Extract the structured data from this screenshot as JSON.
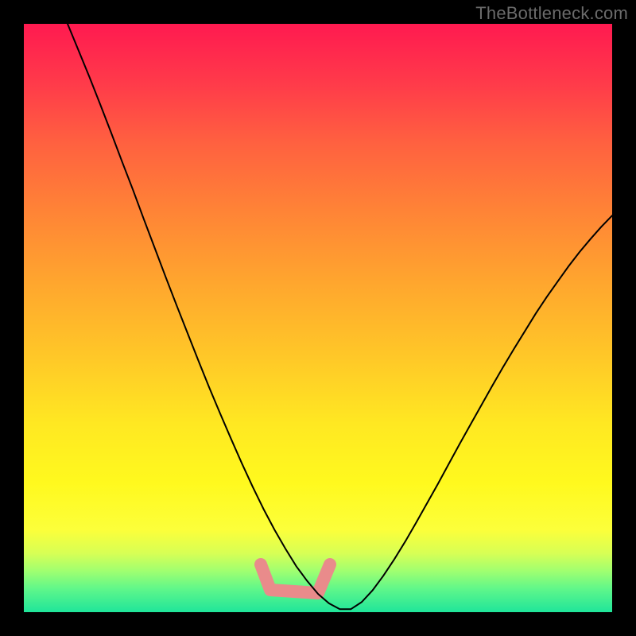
{
  "watermark": "TheBottleneck.com",
  "colors": {
    "background": "#000000",
    "curve": "#000000",
    "trough_highlight": "#e98b8b",
    "gradient_top": "#ff1a50",
    "gradient_bottom": "#1fe59a"
  },
  "chart_data": {
    "type": "line",
    "title": "",
    "xlabel": "",
    "ylabel": "",
    "xlim": [
      0,
      1
    ],
    "ylim": [
      0,
      1
    ],
    "x": [
      0.0,
      0.02,
      0.04,
      0.06,
      0.08,
      0.1,
      0.12,
      0.14,
      0.16,
      0.18,
      0.2,
      0.22,
      0.24,
      0.26,
      0.28,
      0.3,
      0.32,
      0.34,
      0.36,
      0.38,
      0.4,
      0.42,
      0.44,
      0.46,
      0.48,
      0.5,
      0.52,
      0.54,
      0.56,
      0.58,
      0.6,
      0.62,
      0.64,
      0.66,
      0.68,
      0.7,
      0.72,
      0.74,
      0.76,
      0.78,
      0.8,
      0.82,
      0.84,
      0.86,
      0.88,
      0.9,
      0.92,
      0.94,
      0.96,
      0.98,
      1.0
    ],
    "values": [
      1.0,
      0.955,
      0.91,
      0.863,
      0.815,
      0.766,
      0.718,
      0.668,
      0.619,
      0.57,
      0.522,
      0.475,
      0.428,
      0.382,
      0.338,
      0.295,
      0.253,
      0.213,
      0.175,
      0.14,
      0.108,
      0.078,
      0.053,
      0.031,
      0.015,
      0.005,
      0.005,
      0.017,
      0.037,
      0.062,
      0.09,
      0.12,
      0.152,
      0.185,
      0.218,
      0.252,
      0.286,
      0.319,
      0.352,
      0.385,
      0.417,
      0.448,
      0.478,
      0.508,
      0.536,
      0.562,
      0.588,
      0.612,
      0.634,
      0.655,
      0.674
    ],
    "trough": {
      "x_range": [
        0.4,
        0.53
      ],
      "y": 0.01
    }
  }
}
